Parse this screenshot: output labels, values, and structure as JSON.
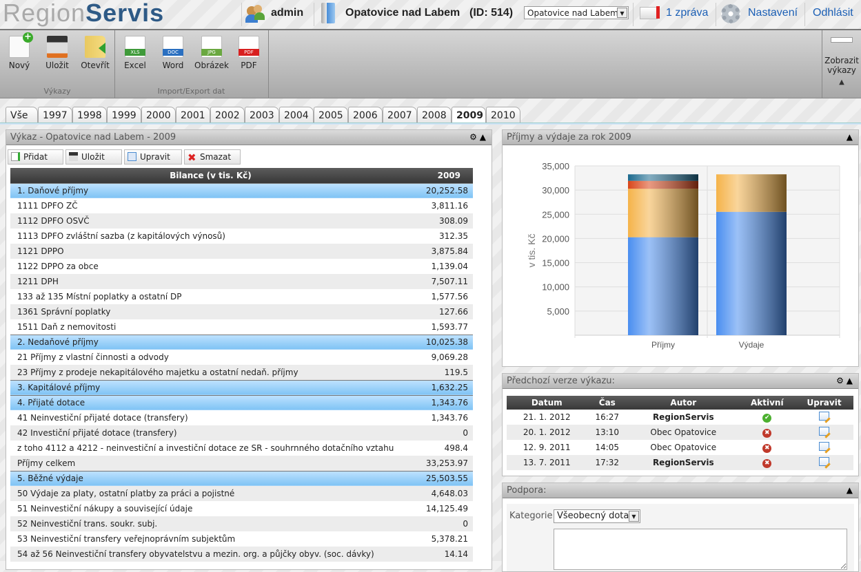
{
  "header": {
    "logo_light": "Region",
    "logo_bold": "Servis",
    "user": "admin",
    "municipality": "Opatovice nad Labem",
    "id_label": "(ID: 514)",
    "municipality_select": "Opatovice nad Labem",
    "messages": "1 zpráva",
    "settings": "Nastavení",
    "logout": "Odhlásit"
  },
  "toolbar": {
    "groups": [
      {
        "label": "Výkazy",
        "buttons": [
          "Nový",
          "Uložit",
          "Otevřít"
        ]
      },
      {
        "label": "Import/Export dat",
        "buttons": [
          "Excel",
          "Word",
          "Obrázek",
          "PDF"
        ]
      }
    ],
    "show_reports": "Zobrazit výkazy",
    "icon_tags": [
      "XLS",
      "DOC",
      "JPG",
      "PDF"
    ]
  },
  "tabs": [
    "Vše",
    "1997",
    "1998",
    "1999",
    "2000",
    "2001",
    "2002",
    "2003",
    "2004",
    "2005",
    "2006",
    "2007",
    "2008",
    "2009",
    "2010"
  ],
  "active_tab": "2009",
  "report": {
    "title": "Výkaz - Opatovice nad Labem - 2009",
    "actions": [
      "Přidat",
      "Uložit",
      "Upravit",
      "Smazat"
    ],
    "columns": [
      "Bilance (v tis. Kč)",
      "2009"
    ],
    "rows": [
      {
        "label": "1. Daňové příjmy",
        "value": "20,252.58",
        "section": true
      },
      {
        "label": "1111 DPFO ZČ",
        "value": "3,811.16"
      },
      {
        "label": "1112 DPFO OSVČ",
        "value": "308.09"
      },
      {
        "label": "1113 DPFO zvláštní sazba (z kapitálových výnosů)",
        "value": "312.35"
      },
      {
        "label": "1121 DPPO",
        "value": "3,875.84"
      },
      {
        "label": "1122 DPPO za obce",
        "value": "1,139.04"
      },
      {
        "label": "1211 DPH",
        "value": "7,507.11"
      },
      {
        "label": "133 až 135 Místní poplatky a ostatní DP",
        "value": "1,577.56"
      },
      {
        "label": "1361 Správní poplatky",
        "value": "127.66"
      },
      {
        "label": "1511 Daň z nemovitosti",
        "value": "1,593.77"
      },
      {
        "label": "2. Nedaňové příjmy",
        "value": "10,025.38",
        "section": true
      },
      {
        "label": "21 Příjmy z vlastní činnosti a odvody",
        "value": "9,069.28"
      },
      {
        "label": "23 Příjmy z prodeje nekapitálového majetku a ostatní nedaň. příjmy",
        "value": "119.5"
      },
      {
        "label": "3. Kapitálové příjmy",
        "value": "1,632.25",
        "section": true
      },
      {
        "label": "4. Přijaté dotace",
        "value": "1,343.76",
        "section": true
      },
      {
        "label": "41 Neinvestiční přijaté dotace (transfery)",
        "value": "1,343.76"
      },
      {
        "label": "42 Investiční přijaté dotace (transfery)",
        "value": "0"
      },
      {
        "label": "z toho 4112 a 4212 - neinvestiční a investiční dotace ze SR - souhrnného dotačního vztahu",
        "value": "498.4"
      },
      {
        "label": "Příjmy celkem",
        "value": "33,253.97"
      },
      {
        "label": "5. Běžné výdaje",
        "value": "25,503.55",
        "section": true
      },
      {
        "label": "50 Výdaje za platy, ostatní platby za práci a pojistné",
        "value": "4,648.03"
      },
      {
        "label": "51 Neinvestiční nákupy a související údaje",
        "value": "14,125.49"
      },
      {
        "label": "52 Neinvestiční trans. soukr. subj.",
        "value": "0"
      },
      {
        "label": "53 Neinvestiční transfery veřejnoprávním subjektům",
        "value": "5,378.21"
      },
      {
        "label": "54 až 56 Neinvestiční transfery obyvatelstvu a mezin. org. a půjčky obyv. (soc. dávky)",
        "value": "14.14"
      }
    ]
  },
  "chart_panel": {
    "title": "Příjmy a výdaje za rok 2009"
  },
  "chart_data": {
    "type": "bar",
    "stacked": true,
    "categories": [
      "Příjmy",
      "Výdaje"
    ],
    "ylabel": "v tis. Kč",
    "ylim": [
      0,
      35000
    ],
    "yticks": [
      "5,000",
      "10,000",
      "15,000",
      "20,000",
      "25,000",
      "30,000",
      "35,000"
    ],
    "grid": true,
    "series": [
      {
        "values": [
          20252.58,
          25503.55
        ],
        "color": "#4a8ef0"
      },
      {
        "values": [
          10025.38,
          7750
        ],
        "color": "#f5b34a"
      },
      {
        "values": [
          1632.25,
          0
        ],
        "color": "#d9461a"
      },
      {
        "values": [
          1343.76,
          0
        ],
        "color": "#1c6a8e"
      }
    ]
  },
  "versions": {
    "title": "Předchozí verze výkazu:",
    "columns": [
      "Datum",
      "Čas",
      "Autor",
      "Aktivní",
      "Upravit"
    ],
    "rows": [
      {
        "date": "21. 1. 2012",
        "time": "16:27",
        "author": "RegionServis",
        "bold": true,
        "active": true
      },
      {
        "date": "20. 1. 2012",
        "time": "13:10",
        "author": "Obec Opatovice",
        "bold": false,
        "active": false
      },
      {
        "date": "12. 9. 2011",
        "time": "14:05",
        "author": "Obec Opatovice",
        "bold": false,
        "active": false
      },
      {
        "date": "13. 7. 2011",
        "time": "17:32",
        "author": "RegionServis",
        "bold": true,
        "active": false
      }
    ]
  },
  "support": {
    "title": "Podpora:",
    "category_label": "Kategorie",
    "category_value": "Všeobecný dotaz",
    "message": ""
  }
}
